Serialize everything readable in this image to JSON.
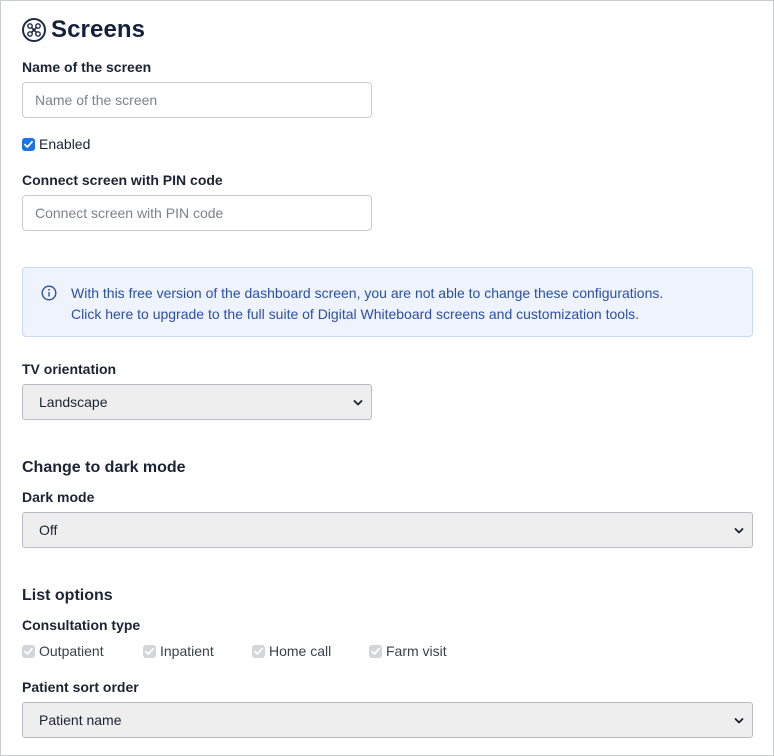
{
  "header": {
    "title": "Screens",
    "icon": "drone-icon"
  },
  "name_field": {
    "label": "Name of the screen",
    "placeholder": "Name of the screen",
    "value": ""
  },
  "enabled": {
    "label": "Enabled",
    "checked": true
  },
  "pin_field": {
    "label": "Connect screen with PIN code",
    "placeholder": "Connect screen with PIN code",
    "value": ""
  },
  "info": {
    "icon": "info-icon",
    "line1": "With this free version of the dashboard screen, you are not able to change these configurations.",
    "line2": "Click here to upgrade to the full suite of Digital Whiteboard screens and customization tools."
  },
  "tv_orientation": {
    "label": "TV orientation",
    "selected": "Landscape"
  },
  "dark_mode_section": {
    "heading": "Change to dark mode",
    "label": "Dark mode",
    "selected": "Off"
  },
  "list_options": {
    "heading": "List options",
    "consultation_label": "Consultation type",
    "consultation_types": [
      {
        "label": "Outpatient",
        "checked": true,
        "disabled": true
      },
      {
        "label": "Inpatient",
        "checked": true,
        "disabled": true
      },
      {
        "label": "Home call",
        "checked": true,
        "disabled": true
      },
      {
        "label": "Farm visit",
        "checked": true,
        "disabled": true
      }
    ],
    "sort_label": "Patient sort order",
    "sort_selected": "Patient name"
  },
  "colors": {
    "accent": "#1a73e8",
    "info_text": "#2b4fa8",
    "info_bg": "#eef3fd",
    "title": "#14213d"
  }
}
